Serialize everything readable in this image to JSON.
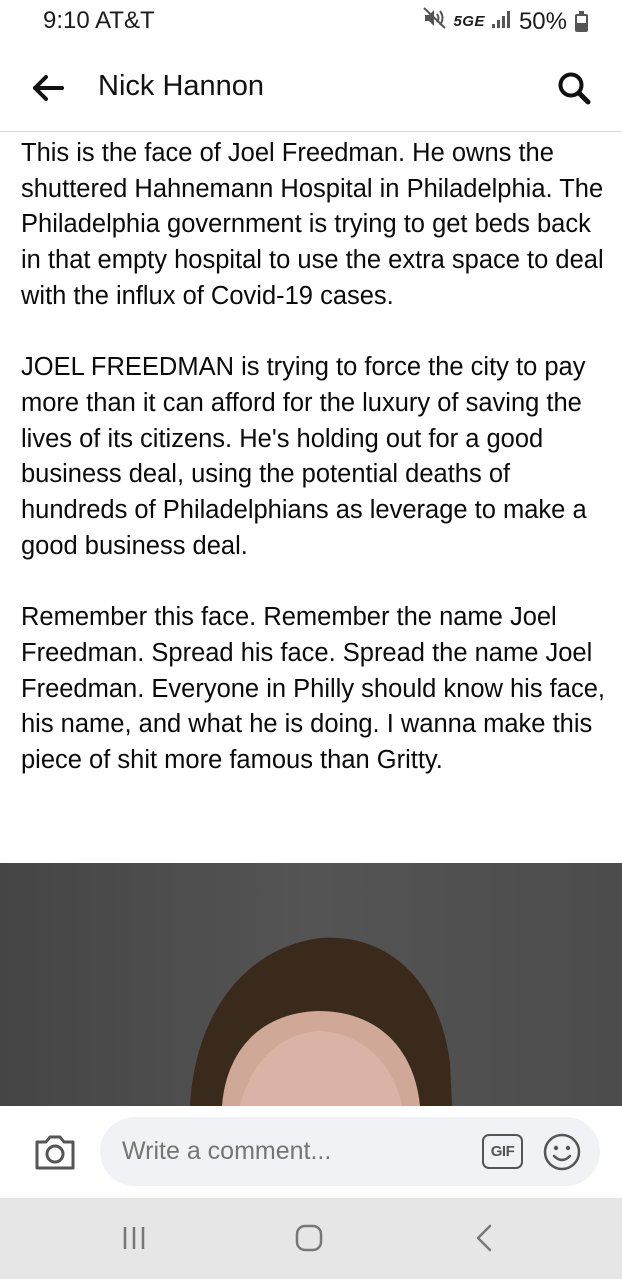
{
  "status_bar": {
    "time": "9:10",
    "carrier": "AT&T",
    "network": "5GE",
    "battery": "50%",
    "battery_level": 0.5,
    "icons": [
      "mute-icon",
      "signal-icon",
      "battery-icon"
    ]
  },
  "header": {
    "title": "Nick Hannon",
    "back_icon": "arrow-left-icon",
    "search_icon": "search-icon"
  },
  "post": {
    "paragraphs": [
      "This is the face of Joel Freedman. He owns the shuttered Hahnemann Hospital in Philadelphia. The Philadelphia government is trying to get beds back in that empty hospital to use the extra space to deal with the influx of Covid-19 cases.",
      "JOEL FREEDMAN is trying to force the city to pay more than it can afford for the luxury of saving the lives of its citizens. He's holding out for a good business deal, using the potential deaths of hundreds of Philadelphians as leverage to make a good business deal.",
      "Remember this face. Remember the name Joel Freedman. Spread his face. Spread the name Joel Freedman. Everyone in Philly should know his face, his name, and what he is doing. I wanna make this piece of shit more famous than Gritty."
    ]
  },
  "comment_bar": {
    "placeholder": "Write a comment...",
    "gif_label": "GIF",
    "icons": [
      "camera-icon",
      "emoji-icon"
    ]
  },
  "nav_bar": {
    "icons": [
      "recent-apps-icon",
      "home-icon",
      "back-icon"
    ]
  },
  "colors": {
    "text": "#050505",
    "comment_box": "#f0f2f5",
    "nav_bar": "#e6e6e6",
    "photo_bg": "#4a4a4a"
  }
}
